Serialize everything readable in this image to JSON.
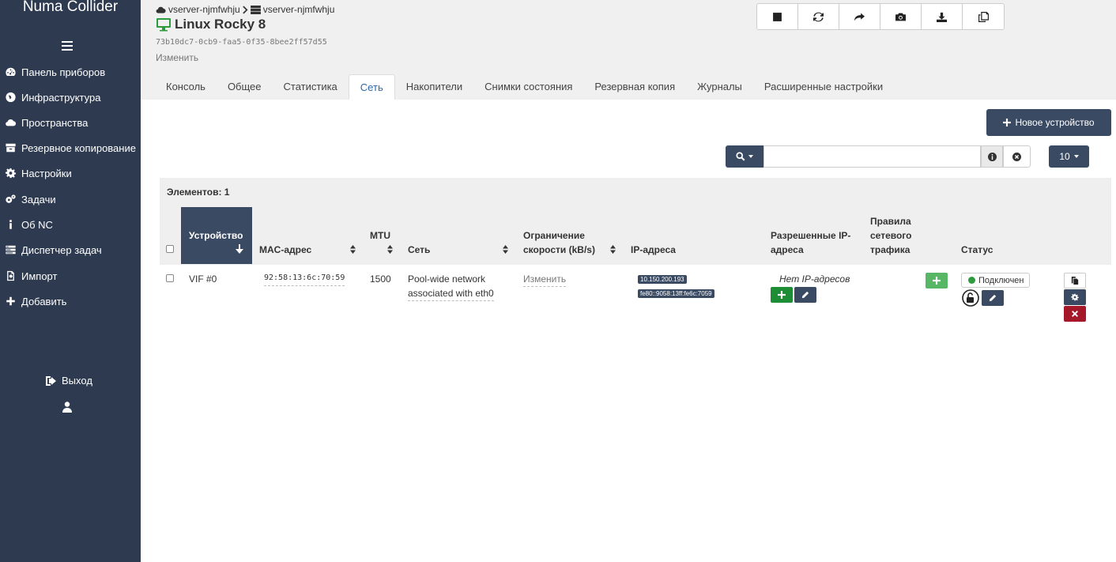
{
  "sidebar": {
    "brand": "Numa Collider",
    "items": [
      {
        "label": "Панель приборов",
        "icon": "dashboard-icon"
      },
      {
        "label": "Инфраструктура",
        "icon": "globe-icon"
      },
      {
        "label": "Пространства",
        "icon": "cloud-icon"
      },
      {
        "label": "Резервное копирование",
        "icon": "archive-icon"
      },
      {
        "label": "Настройки",
        "icon": "gear-icon"
      },
      {
        "label": "Задачи",
        "icon": "gears-icon"
      },
      {
        "label": "Об NC",
        "icon": "info-icon"
      },
      {
        "label": "Диспетчер задач",
        "icon": "tasks-icon"
      },
      {
        "label": "Импорт",
        "icon": "import-icon"
      },
      {
        "label": "Добавить",
        "icon": "plus-icon"
      }
    ],
    "logout_label": "Выход"
  },
  "header": {
    "breadcrumb_pool": "vserver-njmfwhju",
    "breadcrumb_host": "vserver-njmfwhju",
    "vm_name": "Linux Rocky 8",
    "uuid": "73b10dc7-0cb9-faa5-0f35-8bee2ff57d55",
    "edit_label": "Изменить",
    "tabs": [
      "Консоль",
      "Общее",
      "Статистика",
      "Сеть",
      "Накопители",
      "Снимки состояния",
      "Резервная копия",
      "Журналы",
      "Расширенные настройки"
    ],
    "active_tab": "Сеть"
  },
  "toolbar": {
    "new_device_label": "Новое устройство",
    "per_page": "10",
    "search_value": ""
  },
  "table": {
    "count_label": "Элементов: 1",
    "headers": {
      "device": "Устройство",
      "mac": "MAC-адрес",
      "mtu": "MTU",
      "network": "Сеть",
      "rate_limit_1": "Ограничение",
      "rate_limit_2": "скорости (kB/s)",
      "ips": "IP-адреса",
      "allowed_1": "Разрешенные IP-",
      "allowed_2": "адреса",
      "traffic_1": "Правила",
      "traffic_2": "сетевого",
      "traffic_3": "трафика",
      "status": "Статус"
    },
    "rows": [
      {
        "device": "VIF #0",
        "mac": "92:58:13:6c:70:59",
        "mtu": "1500",
        "network_1": "Pool-wide network",
        "network_2": "associated with eth0",
        "rate_limit": "Изменить",
        "ip_1": "10.150.200.193",
        "ip_2": "fe80::9058:13ff:fe6c:7059",
        "allowed": "Нет IP-адресов",
        "status": "Подключен"
      }
    ]
  },
  "colors": {
    "sidebar_bg": "#2e3a50",
    "accent": "#3b4a63",
    "success": "#2e9c3e",
    "danger": "#a5182a",
    "tab_active": "#2f6aa8"
  }
}
